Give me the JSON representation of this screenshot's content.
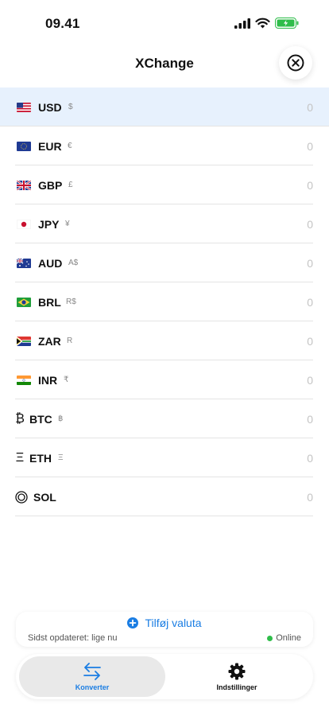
{
  "status_bar": {
    "time": "09.41"
  },
  "header": {
    "title": "XChange"
  },
  "currencies": [
    {
      "code": "USD",
      "symbol": "$",
      "value": "0",
      "icon": "us-flag-icon",
      "active": true
    },
    {
      "code": "EUR",
      "symbol": "€",
      "value": "0",
      "icon": "eu-flag-icon"
    },
    {
      "code": "GBP",
      "symbol": "£",
      "value": "0",
      "icon": "uk-flag-icon"
    },
    {
      "code": "JPY",
      "symbol": "¥",
      "value": "0",
      "icon": "japan-flag-icon"
    },
    {
      "code": "AUD",
      "symbol": "A$",
      "value": "0",
      "icon": "australia-flag-icon"
    },
    {
      "code": "BRL",
      "symbol": "R$",
      "value": "0",
      "icon": "brazil-flag-icon"
    },
    {
      "code": "ZAR",
      "symbol": "R",
      "value": "0",
      "icon": "south-africa-flag-icon"
    },
    {
      "code": "INR",
      "symbol": "₹",
      "value": "0",
      "icon": "india-flag-icon"
    },
    {
      "code": "BTC",
      "symbol": "฿",
      "value": "0",
      "icon": "bitcoin-icon"
    },
    {
      "code": "ETH",
      "symbol": "Ξ",
      "value": "0",
      "icon": "ethereum-icon"
    },
    {
      "code": "SOL",
      "symbol": "",
      "value": "0",
      "icon": "solana-icon"
    }
  ],
  "footer": {
    "add_label": "Tilføj valuta",
    "updated_text": "Sidst opdateret: lige nu",
    "status_text": "Online"
  },
  "tabs": [
    {
      "label": "Konverter",
      "icon": "convert-arrows-icon",
      "active": true
    },
    {
      "label": "Indstillinger",
      "icon": "gear-icon"
    }
  ],
  "colors": {
    "accent": "#1a7de3",
    "active_row": "#e7f1fd",
    "online": "#2fbd4a"
  }
}
